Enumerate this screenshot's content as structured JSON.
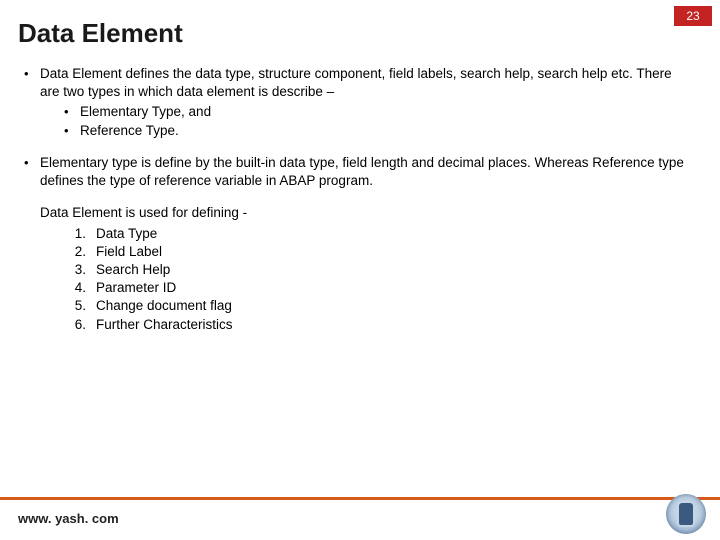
{
  "pageNumber": "23",
  "title": "Data Element",
  "bullets": [
    {
      "text": "Data Element defines the data type, structure component, field labels, search help, search help etc. There are two types in which data element is describe –",
      "sub": [
        "Elementary Type, and",
        " Reference Type."
      ]
    },
    {
      "text": "Elementary type is define by the built-in data type, field length and decimal places. Whereas Reference type defines the type of reference variable in ABAP program."
    }
  ],
  "definingIntro": "Data Element is used for defining -",
  "definingList": [
    "Data Type",
    "Field Label",
    "Search Help",
    "Parameter ID",
    "Change document flag",
    "Further Characteristics"
  ],
  "footerUrl": "www. yash. com"
}
